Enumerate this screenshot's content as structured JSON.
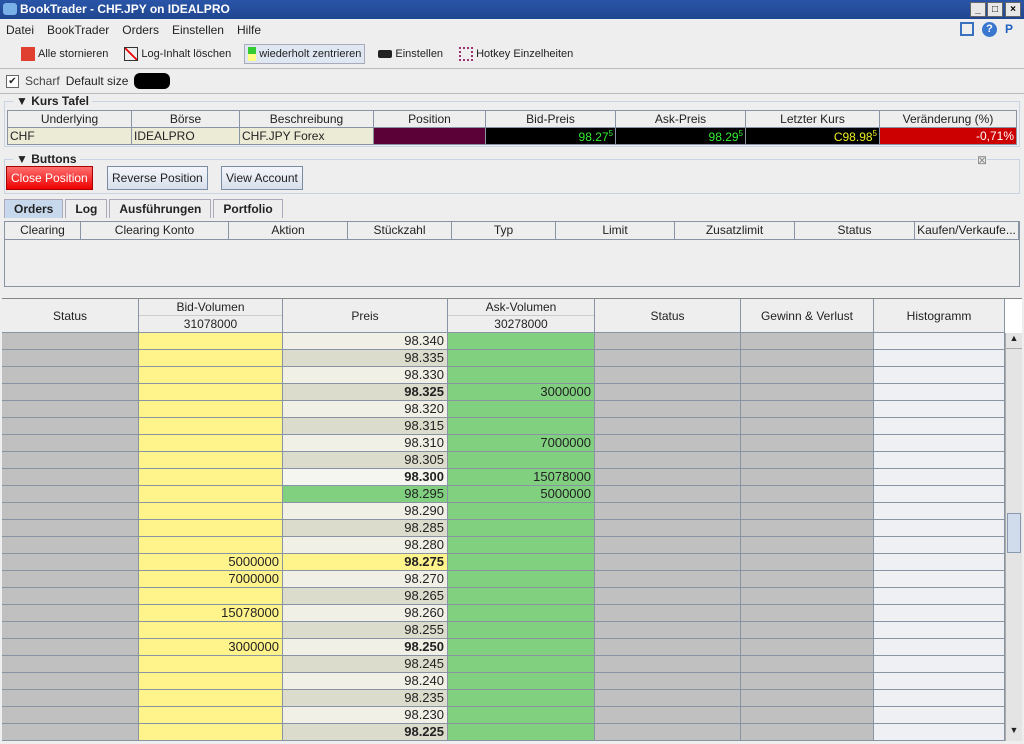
{
  "window": {
    "title": "BookTrader - CHF.JPY on IDEALPRO"
  },
  "menu": [
    "Datei",
    "BookTrader",
    "Orders",
    "Einstellen",
    "Hilfe"
  ],
  "toolbar": [
    {
      "label": "Alle stornieren",
      "icon": "cancel-all-icon"
    },
    {
      "label": "Log-Inhalt löschen",
      "icon": "clear-log-icon"
    },
    {
      "label": "wiederholt zentrieren",
      "icon": "recenter-icon"
    },
    {
      "label": "Einstellen",
      "icon": "settings-icon"
    },
    {
      "label": "Hotkey Einzelheiten",
      "icon": "hotkey-icon"
    }
  ],
  "options": {
    "scharf_label": "Scharf",
    "scharf_checked": true,
    "default_size_label": "Default size"
  },
  "kurs_tafel": {
    "title": "Kurs Tafel",
    "headers": [
      "Underlying",
      "Börse",
      "Beschreibung",
      "Position",
      "Bid-Preis",
      "Ask-Preis",
      "Letzter Kurs",
      "Veränderung (%)"
    ],
    "row": {
      "underlying": "CHF",
      "exchange": "IDEALPRO",
      "description": "CHF.JPY Forex",
      "position": "",
      "bid": "98.27",
      "bid_sup": "5",
      "ask": "98.29",
      "ask_sup": "5",
      "last": "C98.98",
      "last_sup": "5",
      "change": "-0,71%"
    }
  },
  "buttons": {
    "title": "Buttons",
    "close": "Close Position",
    "reverse": "Reverse Position",
    "view": "View Account"
  },
  "tabs": [
    "Orders",
    "Log",
    "Ausführungen",
    "Portfolio"
  ],
  "orders": {
    "headers": [
      "Clearing",
      "Clearing Konto",
      "Aktion",
      "Stückzahl",
      "Typ",
      "Limit",
      "Zusatzlimit",
      "Status",
      "Kaufen/Verkaufe..."
    ]
  },
  "book": {
    "headers": {
      "status": "Status",
      "bid_volume": "Bid-Volumen",
      "bid_total": "31078000",
      "price": "Preis",
      "ask_volume": "Ask-Volumen",
      "ask_total": "30278000",
      "status2": "Status",
      "pnl": "Gewinn & Verlust",
      "histogram": "Histogramm"
    },
    "rows": [
      {
        "price": "98.340",
        "bid": "",
        "ask": ""
      },
      {
        "price": "98.335",
        "bid": "",
        "ask": ""
      },
      {
        "price": "98.330",
        "bid": "",
        "ask": ""
      },
      {
        "price": "98.325",
        "bid": "",
        "ask": "3000000"
      },
      {
        "price": "98.320",
        "bid": "",
        "ask": ""
      },
      {
        "price": "98.315",
        "bid": "",
        "ask": ""
      },
      {
        "price": "98.310",
        "bid": "",
        "ask": "7000000"
      },
      {
        "price": "98.305",
        "bid": "",
        "ask": ""
      },
      {
        "price": "98.300",
        "bid": "",
        "ask": "15078000"
      },
      {
        "price": "98.295",
        "bid": "",
        "ask": "5000000"
      },
      {
        "price": "98.290",
        "bid": "",
        "ask": ""
      },
      {
        "price": "98.285",
        "bid": "",
        "ask": ""
      },
      {
        "price": "98.280",
        "bid": "",
        "ask": ""
      },
      {
        "price": "98.275",
        "bid": "5000000",
        "ask": ""
      },
      {
        "price": "98.270",
        "bid": "7000000",
        "ask": ""
      },
      {
        "price": "98.265",
        "bid": "",
        "ask": ""
      },
      {
        "price": "98.260",
        "bid": "15078000",
        "ask": ""
      },
      {
        "price": "98.255",
        "bid": "",
        "ask": ""
      },
      {
        "price": "98.250",
        "bid": "3000000",
        "ask": ""
      },
      {
        "price": "98.245",
        "bid": "",
        "ask": ""
      },
      {
        "price": "98.240",
        "bid": "",
        "ask": ""
      },
      {
        "price": "98.235",
        "bid": "",
        "ask": ""
      },
      {
        "price": "98.230",
        "bid": "",
        "ask": ""
      },
      {
        "price": "98.225",
        "bid": "",
        "ask": ""
      }
    ]
  },
  "colors": {
    "bid": "#fff38c",
    "ask": "#80d080",
    "status": "#c0c0c0",
    "price_a": "#f0f0e6",
    "price_b": "#dcdccc",
    "best_ask": "#80d080",
    "best_bid": "#fff38c"
  }
}
